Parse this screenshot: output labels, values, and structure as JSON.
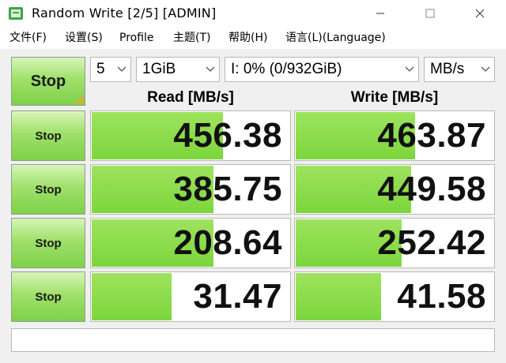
{
  "window": {
    "title": "Random Write [2/5] [ADMIN]",
    "icons": [
      "app-icon",
      "minimize-icon",
      "maximize-icon",
      "close-icon"
    ]
  },
  "menu": {
    "items": [
      "文件(F)",
      "设置(S)",
      "Profile",
      "主题(T)",
      "帮助(H)",
      "语言(L)(Language)"
    ]
  },
  "controls": {
    "main_button": "Stop",
    "count": "5",
    "size": "1GiB",
    "drive": "I: 0% (0/932GiB)",
    "unit": "MB/s"
  },
  "headers": {
    "read": "Read [MB/s]",
    "write": "Write [MB/s]"
  },
  "rows": [
    {
      "button": "Stop",
      "read": "456.38",
      "write": "463.87",
      "read_level": 0.66,
      "write_level": 0.6
    },
    {
      "button": "Stop",
      "read": "385.75",
      "write": "449.58",
      "read_level": 0.61,
      "write_level": 0.58
    },
    {
      "button": "Stop",
      "read": "208.64",
      "write": "252.42",
      "read_level": 0.61,
      "write_level": 0.53
    },
    {
      "button": "Stop",
      "read": "31.47",
      "write": "41.58",
      "read_level": 0.4,
      "write_level": 0.43
    }
  ],
  "status_text": "",
  "colors": {
    "bar_green": "#7cd63c",
    "button_green": "#9fe06a",
    "corner_orange": "#f5a623"
  }
}
